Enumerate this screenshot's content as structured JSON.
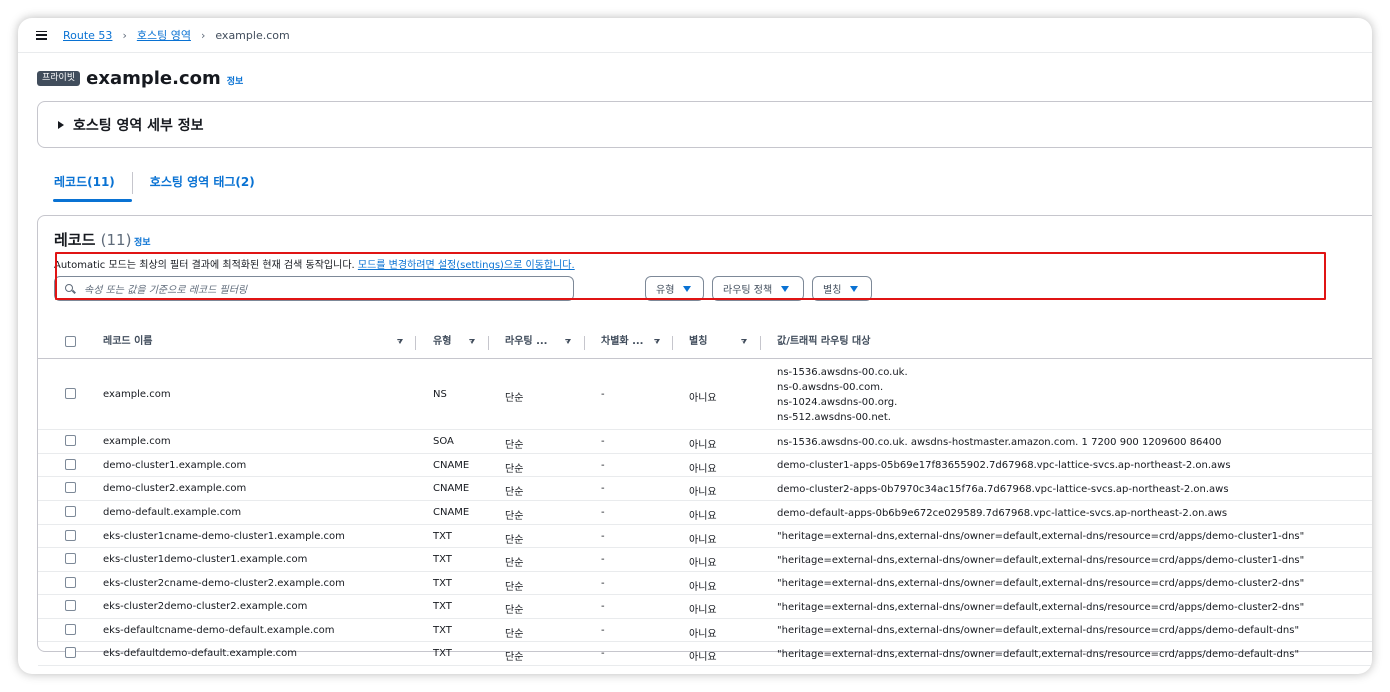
{
  "breadcrumb": {
    "items": [
      "Route 53",
      "호스팅 영역",
      "example.com"
    ]
  },
  "header": {
    "badge": "프라이빗",
    "title": "example.com",
    "info": "정보"
  },
  "details": {
    "title": "호스팅 영역 세부 정보"
  },
  "tabs": [
    {
      "label": "레코드(11)"
    },
    {
      "label": "호스팅 영역 태그(2)"
    }
  ],
  "records": {
    "title": "레코드",
    "count": "(11)",
    "info": "정보",
    "description": "Automatic 모드는 최상의 필터 결과에 최적화된 현재 검색 동작입니다.",
    "description_link": "모드를 변경하려면 설정(settings)으로 이동합니다.",
    "search_placeholder": "속성 또는 값을 기준으로 레코드 필터링",
    "filters": {
      "type": "유형",
      "routing_policy": "라우팅 정책",
      "alias": "별칭"
    },
    "columns": {
      "name": "레코드 이름",
      "type": "유형",
      "routing": "라우팅 ...",
      "differentiator": "차별화 ...",
      "alias": "별칭",
      "value": "값/트래픽 라우팅 대상"
    },
    "rows": [
      {
        "name": "example.com",
        "type": "NS",
        "routing": "단순",
        "diff": "-",
        "alias": "아니요",
        "values": [
          "ns-1536.awsdns-00.co.uk.",
          "ns-0.awsdns-00.com.",
          "ns-1024.awsdns-00.org.",
          "ns-512.awsdns-00.net."
        ]
      },
      {
        "name": "example.com",
        "type": "SOA",
        "routing": "단순",
        "diff": "-",
        "alias": "아니요",
        "values": [
          "ns-1536.awsdns-00.co.uk. awsdns-hostmaster.amazon.com. 1 7200 900 1209600 86400"
        ]
      },
      {
        "name": "demo-cluster1.example.com",
        "type": "CNAME",
        "routing": "단순",
        "diff": "-",
        "alias": "아니요",
        "values": [
          "demo-cluster1-apps-05b69e17f83655902.7d67968.vpc-lattice-svcs.ap-northeast-2.on.aws"
        ]
      },
      {
        "name": "demo-cluster2.example.com",
        "type": "CNAME",
        "routing": "단순",
        "diff": "-",
        "alias": "아니요",
        "values": [
          "demo-cluster2-apps-0b7970c34ac15f76a.7d67968.vpc-lattice-svcs.ap-northeast-2.on.aws"
        ]
      },
      {
        "name": "demo-default.example.com",
        "type": "CNAME",
        "routing": "단순",
        "diff": "-",
        "alias": "아니요",
        "values": [
          "demo-default-apps-0b6b9e672ce029589.7d67968.vpc-lattice-svcs.ap-northeast-2.on.aws"
        ]
      },
      {
        "name": "eks-cluster1cname-demo-cluster1.example.com",
        "type": "TXT",
        "routing": "단순",
        "diff": "-",
        "alias": "아니요",
        "values": [
          "\"heritage=external-dns,external-dns/owner=default,external-dns/resource=crd/apps/demo-cluster1-dns\""
        ]
      },
      {
        "name": "eks-cluster1demo-cluster1.example.com",
        "type": "TXT",
        "routing": "단순",
        "diff": "-",
        "alias": "아니요",
        "values": [
          "\"heritage=external-dns,external-dns/owner=default,external-dns/resource=crd/apps/demo-cluster1-dns\""
        ]
      },
      {
        "name": "eks-cluster2cname-demo-cluster2.example.com",
        "type": "TXT",
        "routing": "단순",
        "diff": "-",
        "alias": "아니요",
        "values": [
          "\"heritage=external-dns,external-dns/owner=default,external-dns/resource=crd/apps/demo-cluster2-dns\""
        ]
      },
      {
        "name": "eks-cluster2demo-cluster2.example.com",
        "type": "TXT",
        "routing": "단순",
        "diff": "-",
        "alias": "아니요",
        "values": [
          "\"heritage=external-dns,external-dns/owner=default,external-dns/resource=crd/apps/demo-cluster2-dns\""
        ]
      },
      {
        "name": "eks-defaultcname-demo-default.example.com",
        "type": "TXT",
        "routing": "단순",
        "diff": "-",
        "alias": "아니요",
        "values": [
          "\"heritage=external-dns,external-dns/owner=default,external-dns/resource=crd/apps/demo-default-dns\""
        ]
      },
      {
        "name": "eks-defaultdemo-default.example.com",
        "type": "TXT",
        "routing": "단순",
        "diff": "-",
        "alias": "아니요",
        "values": [
          "\"heritage=external-dns,external-dns/owner=default,external-dns/resource=crd/apps/demo-default-dns\""
        ]
      }
    ]
  },
  "colors": {
    "link": "#0972d3",
    "highlight": "#e01414",
    "badge_bg": "#414d5c"
  }
}
